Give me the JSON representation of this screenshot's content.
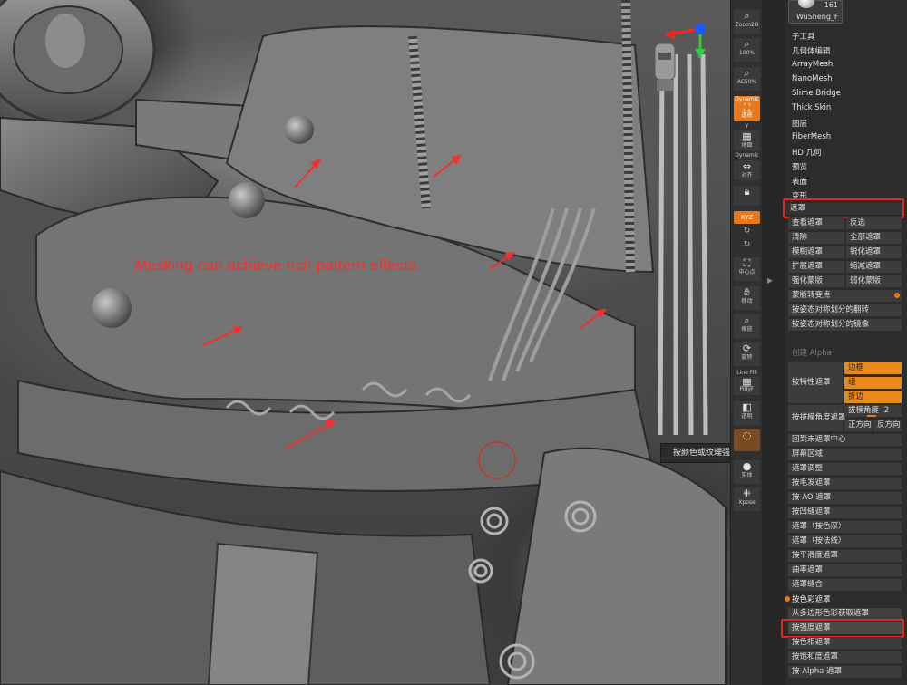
{
  "viewport": {
    "caption": "Masking can achieve rich pattern effects.",
    "tooltip": "按颜色或纹理强度遮罩"
  },
  "shelf": {
    "buttons": [
      {
        "label": "Zoom2D",
        "icon": "zoom-icon"
      },
      {
        "label": "100%",
        "icon": "zoom-icon"
      },
      {
        "label": "AC50%",
        "icon": "zoom-icon"
      },
      {
        "label": "Dynamic",
        "sub": "透视",
        "icon": "perspective-icon",
        "active": true
      },
      {
        "label": "地面",
        "icon": "floor-icon"
      },
      {
        "label": "Dynamic",
        "icon": "text"
      },
      {
        "label": "对齐",
        "icon": "align-icon"
      },
      {
        "label": "",
        "icon": "lock-icon"
      },
      {
        "label": "XYZ",
        "icon": "xyz-icon",
        "active": true
      },
      {
        "label": "中心点",
        "icon": "frame-icon"
      },
      {
        "label": "移动",
        "icon": "move-icon"
      },
      {
        "label": "缩放",
        "icon": "scale-icon"
      },
      {
        "label": "旋转",
        "icon": "rotate-icon"
      },
      {
        "label": "Line Fill",
        "sub": "PolyF",
        "icon": "polyf-icon"
      },
      {
        "label": "透明",
        "icon": "transp-icon"
      },
      {
        "label": "",
        "icon": "ghost-icon",
        "active": true
      },
      {
        "label": "实体",
        "icon": "solo-icon"
      },
      {
        "label": "Xpose",
        "icon": "xpose-icon"
      }
    ]
  },
  "panel": {
    "tool_thumb": {
      "name": "WuSheng_F",
      "count": "161"
    },
    "menu": [
      "子工具",
      "几何体编辑",
      "ArrayMesh",
      "NanoMesh",
      "Slime Bridge",
      "Thick Skin",
      "图层",
      "FiberMesh",
      "HD 几何",
      "预览",
      "表面",
      "变形"
    ],
    "section_title": "遮罩",
    "pairs": [
      [
        "查看遮罩",
        "反选"
      ],
      [
        "清除",
        "全部遮罩"
      ],
      [
        "模糊遮罩",
        "锐化遮罩"
      ],
      [
        "扩展遮罩",
        "缩减遮罩"
      ],
      [
        "强化蒙版",
        "弱化蒙版"
      ]
    ],
    "rows_a": [
      "蒙版转变点",
      "按姿态对称划分的翻转",
      "按姿态对称划分的镜像"
    ],
    "alpha_label": "创建 Alpha",
    "by_feature": {
      "label": "按特性遮罩",
      "options": [
        "边框",
        "组",
        "折边"
      ]
    },
    "by_angle": {
      "label": "按拔模角度遮罩",
      "angle_label": "拔模角度",
      "angle_value": "2",
      "left": "正方向",
      "right": "反方向"
    },
    "rows_b": [
      "回到未遮罩中心",
      "屏幕区域",
      "遮罩调整",
      "按毛发遮罩",
      "按 AO 遮罩",
      "按凹缝遮罩",
      "遮罩（按色深）",
      "遮罩（按法线）",
      "按平滑度遮罩",
      "曲率遮罩",
      "遮罩缝合"
    ],
    "by_color_header": "按色彩遮罩",
    "rows_c": [
      "从多边形色彩获取遮罩",
      "按强度遮罩",
      "按色相遮罩",
      "按饱和度遮罩",
      "按 Alpha 遮罩"
    ]
  },
  "colors": {
    "accent": "#e8781c",
    "highlight": "#e52525",
    "panel": "#2c2c2c"
  }
}
